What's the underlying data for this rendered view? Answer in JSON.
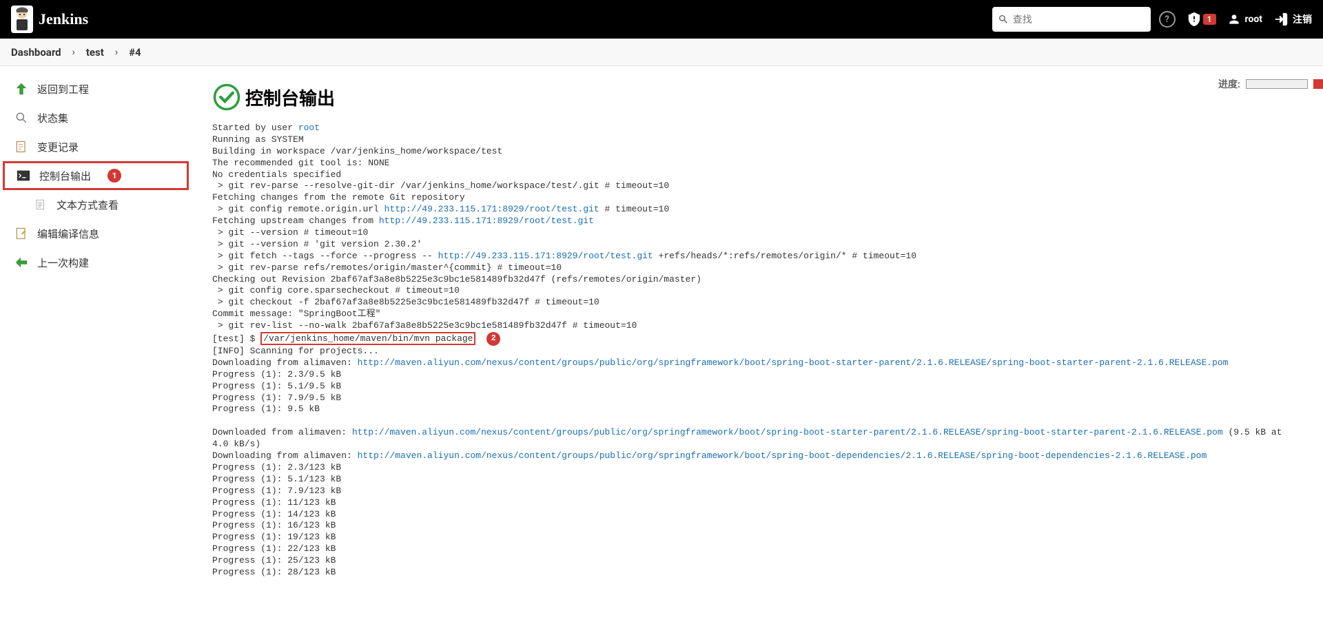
{
  "header": {
    "logo_text": "Jenkins",
    "search_placeholder": "查找",
    "warn_count": "1",
    "username": "root",
    "logout_label": "注销"
  },
  "breadcrumbs": {
    "dashboard": "Dashboard",
    "job": "test",
    "build": "#4"
  },
  "sidebar": {
    "back": "返回到工程",
    "status": "状态集",
    "changes": "变更记录",
    "console": "控制台输出",
    "text_view": "文本方式查看",
    "edit_build": "编辑编译信息",
    "prev_build": "上一次构建"
  },
  "callouts": {
    "one": "1",
    "two": "2"
  },
  "page": {
    "title": "控制台输出",
    "progress_label": "进度:"
  },
  "console": {
    "l01a": "Started by user ",
    "l01b": "root",
    "l02": "Running as SYSTEM",
    "l03": "Building in workspace /var/jenkins_home/workspace/test",
    "l04": "The recommended git tool is: NONE",
    "l05": "No credentials specified",
    "l06": " > git rev-parse --resolve-git-dir /var/jenkins_home/workspace/test/.git # timeout=10",
    "l07": "Fetching changes from the remote Git repository",
    "l08a": " > git config remote.origin.url ",
    "l08b": "http://49.233.115.171:8929/root/test.git",
    "l08c": " # timeout=10",
    "l09a": "Fetching upstream changes from ",
    "l09b": "http://49.233.115.171:8929/root/test.git",
    "l10": " > git --version # timeout=10",
    "l11": " > git --version # 'git version 2.30.2'",
    "l12a": " > git fetch --tags --force --progress -- ",
    "l12b": "http://49.233.115.171:8929/root/test.git",
    "l12c": " +refs/heads/*:refs/remotes/origin/* # timeout=10",
    "l13": " > git rev-parse refs/remotes/origin/master^{commit} # timeout=10",
    "l14": "Checking out Revision 2baf67af3a8e8b5225e3c9bc1e581489fb32d47f (refs/remotes/origin/master)",
    "l15": " > git config core.sparsecheckout # timeout=10",
    "l16": " > git checkout -f 2baf67af3a8e8b5225e3c9bc1e581489fb32d47f # timeout=10",
    "l17": "Commit message: \"SpringBoot工程\"",
    "l18": " > git rev-list --no-walk 2baf67af3a8e8b5225e3c9bc1e581489fb32d47f # timeout=10",
    "l19a": "[test] $ ",
    "l19b": "/var/jenkins_home/maven/bin/mvn package",
    "l20": "[INFO] Scanning for projects...",
    "l21a": "Downloading from alimaven: ",
    "l21b": "http://maven.aliyun.com/nexus/content/groups/public/org/springframework/boot/spring-boot-starter-parent/2.1.6.RELEASE/spring-boot-starter-parent-2.1.6.RELEASE.pom",
    "l22": "Progress (1): 2.3/9.5 kB",
    "l23": "Progress (1): 5.1/9.5 kB",
    "l24": "Progress (1): 7.9/9.5 kB",
    "l25": "Progress (1): 9.5 kB",
    "l26": "                    ",
    "l27a": "Downloaded from alimaven: ",
    "l27b": "http://maven.aliyun.com/nexus/content/groups/public/org/springframework/boot/spring-boot-starter-parent/2.1.6.RELEASE/spring-boot-starter-parent-2.1.6.RELEASE.pom",
    "l27c": " (9.5 kB at 4.0 kB/s)",
    "l28a": "Downloading from alimaven: ",
    "l28b": "http://maven.aliyun.com/nexus/content/groups/public/org/springframework/boot/spring-boot-dependencies/2.1.6.RELEASE/spring-boot-dependencies-2.1.6.RELEASE.pom",
    "l29": "Progress (1): 2.3/123 kB",
    "l30": "Progress (1): 5.1/123 kB",
    "l31": "Progress (1): 7.9/123 kB",
    "l32": "Progress (1): 11/123 kB",
    "l33": "Progress (1): 14/123 kB",
    "l34": "Progress (1): 16/123 kB",
    "l35": "Progress (1): 19/123 kB",
    "l36": "Progress (1): 22/123 kB",
    "l37": "Progress (1): 25/123 kB",
    "l38": "Progress (1): 28/123 kB"
  }
}
